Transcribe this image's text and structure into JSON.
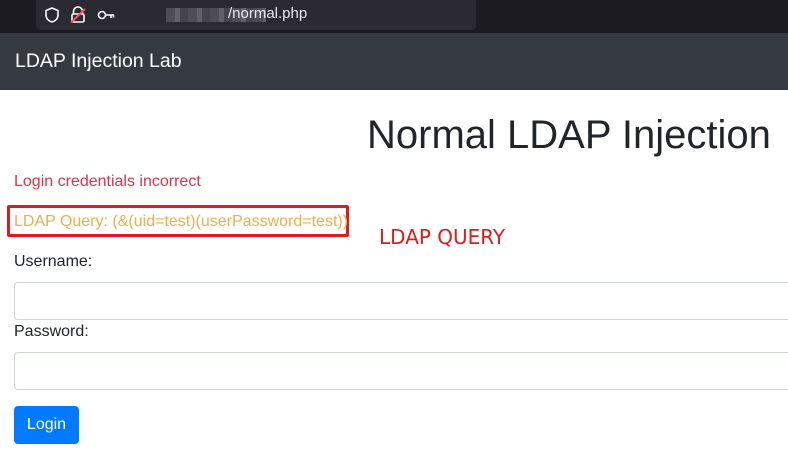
{
  "browser": {
    "url_path": "/normal.php",
    "icons": [
      "shield-icon",
      "page-lock-icon",
      "key-icon"
    ]
  },
  "navbar": {
    "brand": "LDAP Injection Lab"
  },
  "page": {
    "title": "Normal LDAP Injection",
    "error_message": "Login credentials incorrect",
    "ldap_query": "LDAP Query: (&(uid=test)(userPassword=test))",
    "annotation": "LDAP QUERY"
  },
  "form": {
    "username_label": "Username:",
    "username_value": "",
    "password_label": "Password:",
    "password_value": "",
    "login_label": "Login"
  },
  "colors": {
    "navbar_bg": "#343a40",
    "error_red": "#dc3545",
    "query_orange": "#f0ad4e",
    "annotation_red": "#e01b1b",
    "button_blue": "#007bff"
  }
}
